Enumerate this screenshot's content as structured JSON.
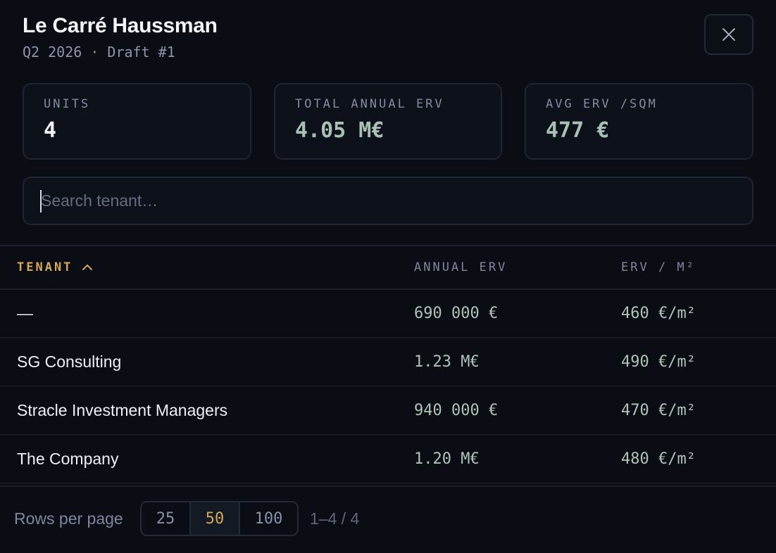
{
  "header": {
    "title": "Le Carré Haussman",
    "subtitle": "Q2 2026 · Draft #1"
  },
  "icons": {
    "close": "close-icon",
    "sort": "chevron-up-icon"
  },
  "stats": [
    {
      "label": "UNITS",
      "value": "4"
    },
    {
      "label": "TOTAL ANNUAL ERV",
      "value": "4.05 M€"
    },
    {
      "label": "AVG ERV /SQM",
      "value": "477 €"
    }
  ],
  "search": {
    "placeholder": "Search tenant…",
    "value": ""
  },
  "table": {
    "columns": {
      "tenant": "TENANT",
      "annual_erv": "ANNUAL ERV",
      "erv_sqm": "ERV / M²"
    },
    "rows": [
      {
        "tenant": "—",
        "annual_erv": "690 000 €",
        "erv_sqm": "460 €/m²"
      },
      {
        "tenant": "SG Consulting",
        "annual_erv": "1.23 M€",
        "erv_sqm": "490 €/m²"
      },
      {
        "tenant": "Stracle Investment Managers",
        "annual_erv": "940 000 €",
        "erv_sqm": "470 €/m²"
      },
      {
        "tenant": "The Company",
        "annual_erv": "1.20 M€",
        "erv_sqm": "480 €/m²"
      }
    ]
  },
  "footer": {
    "rows_per_page_label": "Rows per page",
    "options": [
      "25",
      "50",
      "100"
    ],
    "selected": "50",
    "range": "1–4 / 4"
  },
  "colors": {
    "background": "#0a0d13",
    "accent": "#d4a85a",
    "value_green": "#a9c1b4",
    "muted": "#7f879e"
  }
}
